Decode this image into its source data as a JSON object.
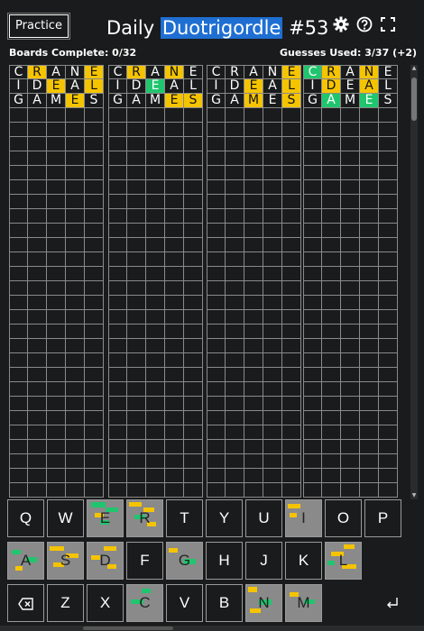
{
  "header": {
    "practice_label": "Practice",
    "title_prefix": "Daily",
    "title_highlight": "Duotrigordle",
    "title_suffix": "#53",
    "icons": [
      "settings-gear",
      "help-circle",
      "fullscreen-corners"
    ]
  },
  "status": {
    "boards_complete": "Boards Complete: 0/32",
    "guesses_used": "Guesses Used: 3/37 (+2)"
  },
  "colors": {
    "background": "#1a1b1c",
    "correct": "#20c56e",
    "present": "#f5c400",
    "absent_key": "#8a8a8a",
    "highlight": "#1f6fd2"
  },
  "boards": [
    {
      "guesses": [
        [
          [
            "C",
            ""
          ],
          [
            "R",
            "y"
          ],
          [
            "A",
            ""
          ],
          [
            "N",
            ""
          ],
          [
            "E",
            "y"
          ]
        ],
        [
          [
            "I",
            ""
          ],
          [
            "D",
            ""
          ],
          [
            "E",
            "y"
          ],
          [
            "A",
            ""
          ],
          [
            "L",
            "y"
          ]
        ],
        [
          [
            "G",
            ""
          ],
          [
            "A",
            ""
          ],
          [
            "M",
            ""
          ],
          [
            "E",
            "y"
          ],
          [
            "S",
            ""
          ]
        ]
      ]
    },
    {
      "guesses": [
        [
          [
            "C",
            ""
          ],
          [
            "R",
            "y"
          ],
          [
            "A",
            ""
          ],
          [
            "N",
            "y"
          ],
          [
            "E",
            ""
          ]
        ],
        [
          [
            "I",
            ""
          ],
          [
            "D",
            ""
          ],
          [
            "E",
            "g"
          ],
          [
            "A",
            ""
          ],
          [
            "L",
            ""
          ]
        ],
        [
          [
            "G",
            ""
          ],
          [
            "A",
            ""
          ],
          [
            "M",
            ""
          ],
          [
            "E",
            "y"
          ],
          [
            "S",
            "y"
          ]
        ]
      ]
    },
    {
      "guesses": [
        [
          [
            "C",
            ""
          ],
          [
            "R",
            ""
          ],
          [
            "A",
            ""
          ],
          [
            "N",
            ""
          ],
          [
            "E",
            "y"
          ]
        ],
        [
          [
            "I",
            ""
          ],
          [
            "D",
            ""
          ],
          [
            "E",
            "y"
          ],
          [
            "A",
            ""
          ],
          [
            "L",
            "y"
          ]
        ],
        [
          [
            "G",
            ""
          ],
          [
            "A",
            ""
          ],
          [
            "M",
            "y"
          ],
          [
            "E",
            ""
          ],
          [
            "S",
            "y"
          ]
        ]
      ]
    },
    {
      "guesses": [
        [
          [
            "C",
            "g"
          ],
          [
            "R",
            "y"
          ],
          [
            "A",
            ""
          ],
          [
            "N",
            "y"
          ],
          [
            "E",
            ""
          ]
        ],
        [
          [
            "I",
            ""
          ],
          [
            "D",
            "y"
          ],
          [
            "E",
            ""
          ],
          [
            "A",
            "y"
          ],
          [
            "L",
            ""
          ]
        ],
        [
          [
            "G",
            ""
          ],
          [
            "A",
            "g"
          ],
          [
            "M",
            ""
          ],
          [
            "E",
            "g"
          ],
          [
            "S",
            ""
          ]
        ]
      ]
    }
  ],
  "keyboard": {
    "rows": [
      [
        "Q",
        "W",
        "E",
        "R",
        "T",
        "Y",
        "U",
        "I",
        "O",
        "P"
      ],
      [
        "A",
        "S",
        "D",
        "F",
        "G",
        "H",
        "J",
        "K",
        "L"
      ],
      [
        "Z",
        "X",
        "C",
        "V",
        "B",
        "N",
        "M"
      ]
    ],
    "used_keys": [
      "E",
      "R",
      "I",
      "A",
      "S",
      "D",
      "G",
      "L",
      "C",
      "N",
      "M"
    ],
    "backspace_icon": "backspace-icon",
    "enter_icon": "enter-icon"
  }
}
